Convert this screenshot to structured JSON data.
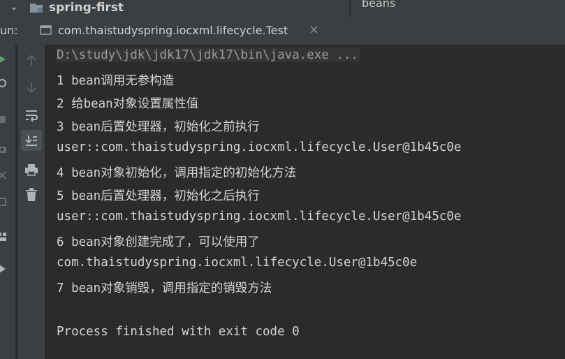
{
  "project_bar": {
    "project_name": "spring-first",
    "right_tab_label": "beans"
  },
  "run_bar": {
    "label": "un:",
    "tab_title": "com.thaistudyspring.iocxml.lifecycle.Test",
    "close_glyph": "×"
  },
  "toolbar": {
    "buttons": [
      {
        "name": "rerun-up-icon"
      },
      {
        "name": "rerun-down-icon"
      },
      {
        "name": "soft-wrap-icon"
      },
      {
        "name": "scroll-to-end-icon"
      },
      {
        "name": "print-icon"
      },
      {
        "name": "trash-icon"
      }
    ]
  },
  "console": {
    "command": "D:\\study\\jdk\\jdk17\\jdk17\\bin\\java.exe ...",
    "lines": [
      "1 bean调用无参构造",
      "2 给bean对象设置属性值",
      "3 bean后置处理器，初始化之前执行",
      "user::com.thaistudyspring.iocxml.lifecycle.User@1b45c0e",
      "4 bean对象初始化，调用指定的初始化方法",
      "5 bean后置处理器，初始化之后执行",
      "user::com.thaistudyspring.iocxml.lifecycle.User@1b45c0e",
      "6 bean对象创建完成了，可以使用了",
      "com.thaistudyspring.iocxml.lifecycle.User@1b45c0e",
      "7 bean对象销毁，调用指定的销毁方法"
    ],
    "exit_message": "Process finished with exit code 0"
  },
  "colors": {
    "console_bg": "#2b2b2b",
    "panel_bg": "#3c3f41",
    "text": "#d4d4d4",
    "run_green": "#59a869"
  }
}
